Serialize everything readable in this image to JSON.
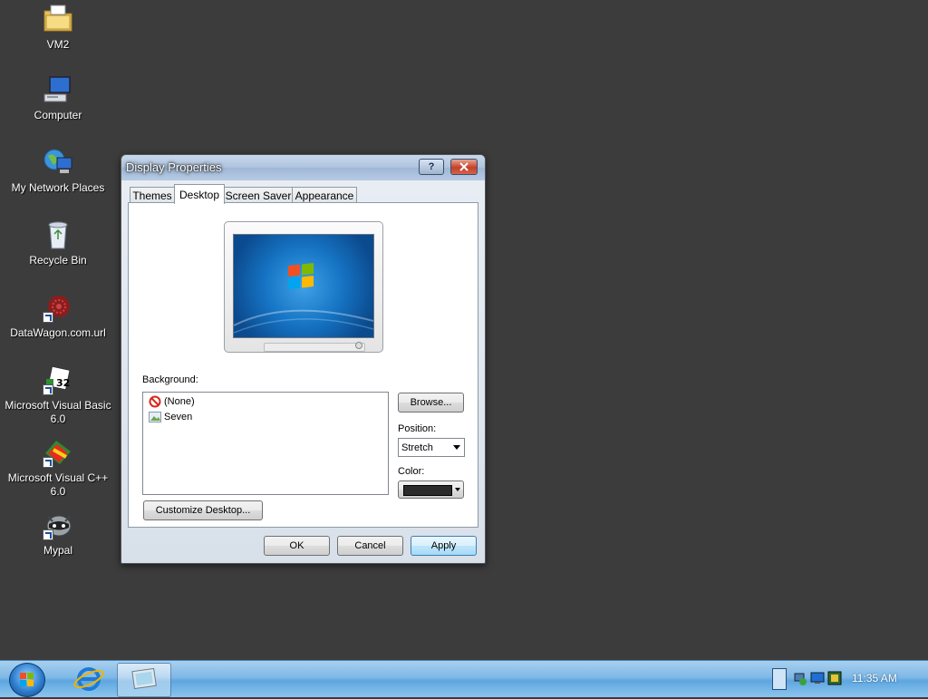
{
  "desktop": {
    "icons": [
      {
        "label": "VM2",
        "icon": "folder-icon"
      },
      {
        "label": "Computer",
        "icon": "computer-icon"
      },
      {
        "label": "My Network Places",
        "icon": "network-places-icon"
      },
      {
        "label": "Recycle Bin",
        "icon": "recycle-bin-icon"
      },
      {
        "label": "DataWagon.com.url",
        "icon": "url-shortcut-icon"
      },
      {
        "label": "Microsoft Visual Basic 6.0",
        "icon": "visual-basic-icon"
      },
      {
        "label": "Microsoft Visual C++ 6.0",
        "icon": "visual-cpp-icon"
      },
      {
        "label": "Mypal",
        "icon": "mypal-raccoon-icon"
      }
    ]
  },
  "dialog": {
    "title": "Display Properties",
    "help_symbol": "?",
    "tabs": [
      {
        "label": "Themes",
        "active": false
      },
      {
        "label": "Desktop",
        "active": true
      },
      {
        "label": "Screen Saver",
        "active": false
      },
      {
        "label": "Appearance",
        "active": false
      }
    ],
    "background": {
      "label": "Background:",
      "items": [
        {
          "label": "(None)",
          "icon": "no-entry-icon"
        },
        {
          "label": "Seven",
          "icon": "image-file-icon"
        }
      ]
    },
    "browse_label": "Browse...",
    "position": {
      "label": "Position:",
      "value": "Stretch"
    },
    "color": {
      "label": "Color:",
      "value": "#2b2b2b"
    },
    "customize_label": "Customize Desktop...",
    "ok_label": "OK",
    "cancel_label": "Cancel",
    "apply_label": "Apply"
  },
  "taskbar": {
    "pinned": [
      {
        "icon": "start-orb-icon"
      },
      {
        "icon": "internet-explorer-icon"
      },
      {
        "icon": "display-properties-icon",
        "active": true
      }
    ],
    "tray_icons": [
      "show-desktop-icon",
      "network-icon",
      "monitor-icon",
      "app-tray-icon"
    ],
    "clock": "11:35 AM"
  }
}
